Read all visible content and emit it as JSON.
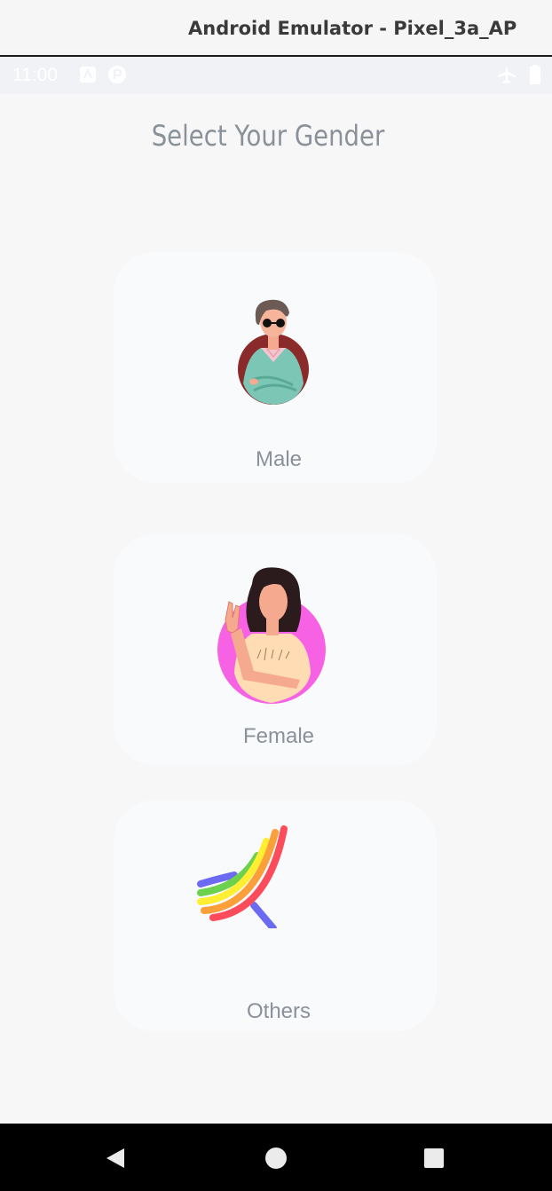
{
  "window": {
    "title": "Android Emulator - Pixel_3a_AP"
  },
  "status_bar": {
    "time": "11:00",
    "icons": [
      "accessibility-icon",
      "pocket-icon",
      "airplane-mode-icon",
      "battery-icon"
    ]
  },
  "page": {
    "title": "Select Your Gender"
  },
  "options": [
    {
      "label": "Male",
      "icon": "male-avatar-icon",
      "avatar_bg": "#8b2a2a"
    },
    {
      "label": "Female",
      "icon": "female-avatar-icon",
      "avatar_bg": "#f761e3"
    },
    {
      "label": "Others",
      "icon": "rainbow-icon",
      "colors": [
        "#6d6af2",
        "#6cd24d",
        "#ffee32",
        "#fb9f3b",
        "#fc4b5b"
      ]
    }
  ],
  "nav": {
    "buttons": [
      "back-icon",
      "home-icon",
      "recents-icon"
    ]
  },
  "colors": {
    "screen_bg": "#f7f7f8",
    "card_bg": "#f9fafb",
    "text_muted": "#8a919a",
    "nav_bg": "#000000"
  }
}
